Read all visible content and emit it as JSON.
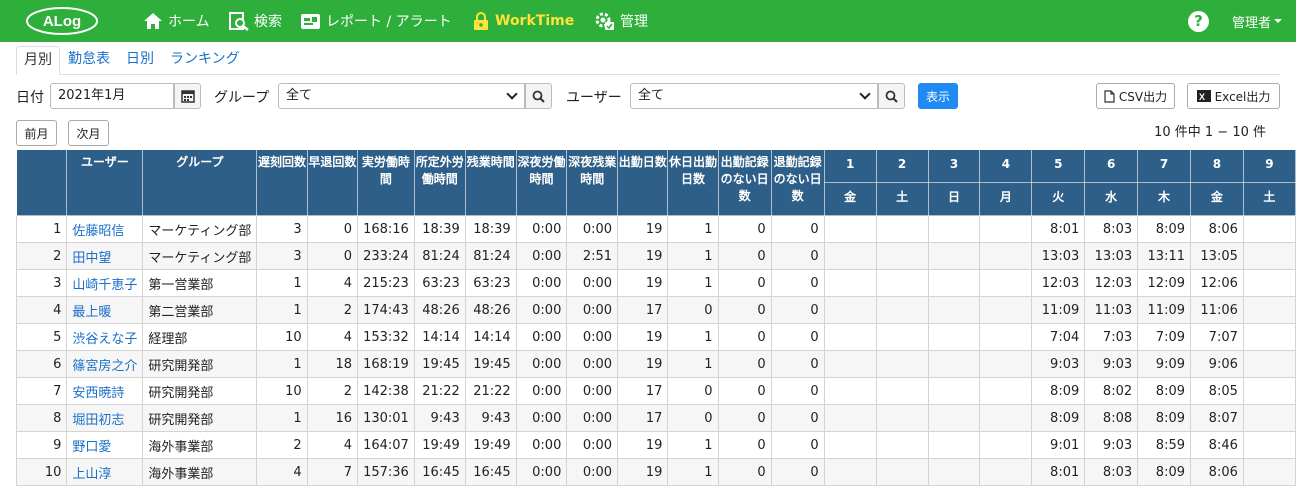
{
  "app": {
    "logo_text": "ALog",
    "nav": [
      {
        "label": "ホーム",
        "icon": "home-icon"
      },
      {
        "label": "検索",
        "icon": "search-doc-icon"
      },
      {
        "label": "レポート / アラート",
        "icon": "report-icon"
      },
      {
        "label": "WorkTime",
        "icon": "lock-icon",
        "active": true
      },
      {
        "label": "管理",
        "icon": "gear-check-icon"
      }
    ],
    "help": "?",
    "admin": "管理者"
  },
  "tabs": [
    "月別",
    "勤怠表",
    "日別",
    "ランキング"
  ],
  "filters": {
    "date_label": "日付",
    "date_value": "2021年1月",
    "group_label": "グループ",
    "group_value": "全て",
    "user_label": "ユーザー",
    "user_value": "全て",
    "show_button": "表示",
    "csv_button": "CSV出力",
    "excel_button": "Excel出力",
    "prev_button": "前月",
    "next_button": "次月",
    "count_text": "10 件中 1 − 10 件"
  },
  "table": {
    "headers": [
      "",
      "ユーザー",
      "グループ",
      "遅刻回数",
      "早退回数",
      "実労働時間",
      "所定外労働時間",
      "残業時間",
      "深夜労働時間",
      "深夜残業時間",
      "出勤日数",
      "休日出勤日数",
      "出勤記録のない日数",
      "退勤記録のない日数"
    ],
    "days": [
      {
        "d": "1",
        "w": "金",
        "color": "red"
      },
      {
        "d": "2",
        "w": "土",
        "color": "cyan"
      },
      {
        "d": "3",
        "w": "日",
        "color": "red"
      },
      {
        "d": "4",
        "w": "月",
        "color": ""
      },
      {
        "d": "5",
        "w": "火",
        "color": ""
      },
      {
        "d": "6",
        "w": "水",
        "color": ""
      },
      {
        "d": "7",
        "w": "木",
        "color": ""
      },
      {
        "d": "8",
        "w": "金",
        "color": ""
      },
      {
        "d": "9",
        "w": "土",
        "color": "cyan"
      }
    ],
    "rows": [
      {
        "no": "1",
        "user": "佐藤昭信",
        "group": "マーケティング部",
        "late": "3",
        "early": "0",
        "actual": "168:16",
        "extra": "18:39",
        "overtime": "18:39",
        "night": "0:00",
        "night_ot": "0:00",
        "work_days": "19",
        "holiday_days": "1",
        "no_in": "0",
        "no_out": "0",
        "days": [
          "",
          "",
          "",
          "",
          "8:01",
          "8:03",
          "8:09",
          "8:06",
          ""
        ]
      },
      {
        "no": "2",
        "user": "田中望",
        "group": "マーケティング部",
        "late": "3",
        "early": "0",
        "actual": "233:24",
        "extra": "81:24",
        "overtime": "81:24",
        "night": "0:00",
        "night_ot": "2:51",
        "work_days": "19",
        "holiday_days": "1",
        "no_in": "0",
        "no_out": "0",
        "days": [
          "",
          "",
          "",
          "",
          "13:03",
          "13:03",
          "13:11",
          "13:05",
          ""
        ]
      },
      {
        "no": "3",
        "user": "山崎千恵子",
        "group": "第一営業部",
        "late": "1",
        "early": "4",
        "actual": "215:23",
        "extra": "63:23",
        "overtime": "63:23",
        "night": "0:00",
        "night_ot": "0:00",
        "work_days": "19",
        "holiday_days": "1",
        "no_in": "0",
        "no_out": "0",
        "days": [
          "",
          "",
          "",
          "",
          "12:03",
          "12:03",
          "12:09",
          "12:06",
          ""
        ]
      },
      {
        "no": "4",
        "user": "最上暖",
        "group": "第二営業部",
        "late": "1",
        "early": "2",
        "actual": "174:43",
        "extra": "48:26",
        "overtime": "48:26",
        "night": "0:00",
        "night_ot": "0:00",
        "work_days": "17",
        "holiday_days": "0",
        "no_in": "0",
        "no_out": "0",
        "days": [
          "",
          "",
          "",
          "",
          "11:09",
          "11:03",
          "11:09",
          "11:06",
          ""
        ]
      },
      {
        "no": "5",
        "user": "渋谷えな子",
        "group": "経理部",
        "late": "10",
        "early": "4",
        "actual": "153:32",
        "extra": "14:14",
        "overtime": "14:14",
        "night": "0:00",
        "night_ot": "0:00",
        "work_days": "19",
        "holiday_days": "1",
        "no_in": "0",
        "no_out": "0",
        "days": [
          "",
          "",
          "",
          "",
          "7:04",
          "7:03",
          "7:09",
          "7:07",
          ""
        ]
      },
      {
        "no": "6",
        "user": "篠宮房之介",
        "group": "研究開発部",
        "late": "1",
        "early": "18",
        "actual": "168:19",
        "extra": "19:45",
        "overtime": "19:45",
        "night": "0:00",
        "night_ot": "0:00",
        "work_days": "19",
        "holiday_days": "1",
        "no_in": "0",
        "no_out": "0",
        "days": [
          "",
          "",
          "",
          "",
          "9:03",
          "9:03",
          "9:09",
          "9:06",
          ""
        ]
      },
      {
        "no": "7",
        "user": "安西暁詩",
        "group": "研究開発部",
        "late": "10",
        "early": "2",
        "actual": "142:38",
        "extra": "21:22",
        "overtime": "21:22",
        "night": "0:00",
        "night_ot": "0:00",
        "work_days": "17",
        "holiday_days": "0",
        "no_in": "0",
        "no_out": "0",
        "days": [
          "",
          "",
          "",
          "",
          "8:09",
          "8:02",
          "8:09",
          "8:05",
          ""
        ]
      },
      {
        "no": "8",
        "user": "堀田初志",
        "group": "研究開発部",
        "late": "1",
        "early": "16",
        "actual": "130:01",
        "extra": "9:43",
        "overtime": "9:43",
        "night": "0:00",
        "night_ot": "0:00",
        "work_days": "17",
        "holiday_days": "0",
        "no_in": "0",
        "no_out": "0",
        "days": [
          "",
          "",
          "",
          "",
          "8:09",
          "8:08",
          "8:09",
          "8:07",
          ""
        ]
      },
      {
        "no": "9",
        "user": "野口愛",
        "group": "海外事業部",
        "late": "2",
        "early": "4",
        "actual": "164:07",
        "extra": "19:49",
        "overtime": "19:49",
        "night": "0:00",
        "night_ot": "0:00",
        "work_days": "19",
        "holiday_days": "1",
        "no_in": "0",
        "no_out": "0",
        "days": [
          "",
          "",
          "",
          "",
          "9:01",
          "9:03",
          "8:59",
          "8:46",
          ""
        ]
      },
      {
        "no": "10",
        "user": "上山淳",
        "group": "海外事業部",
        "late": "4",
        "early": "7",
        "actual": "157:36",
        "extra": "16:45",
        "overtime": "16:45",
        "night": "0:00",
        "night_ot": "0:00",
        "work_days": "19",
        "holiday_days": "1",
        "no_in": "0",
        "no_out": "0",
        "days": [
          "",
          "",
          "",
          "",
          "8:01",
          "8:03",
          "8:09",
          "8:06",
          ""
        ]
      }
    ]
  },
  "colors": {
    "nav_bg": "#2eae3a",
    "header_bg": "#2d5f88",
    "link": "#1a6fc9",
    "active_nav": "#ffe23a",
    "primary_button": "#1e8af2"
  }
}
